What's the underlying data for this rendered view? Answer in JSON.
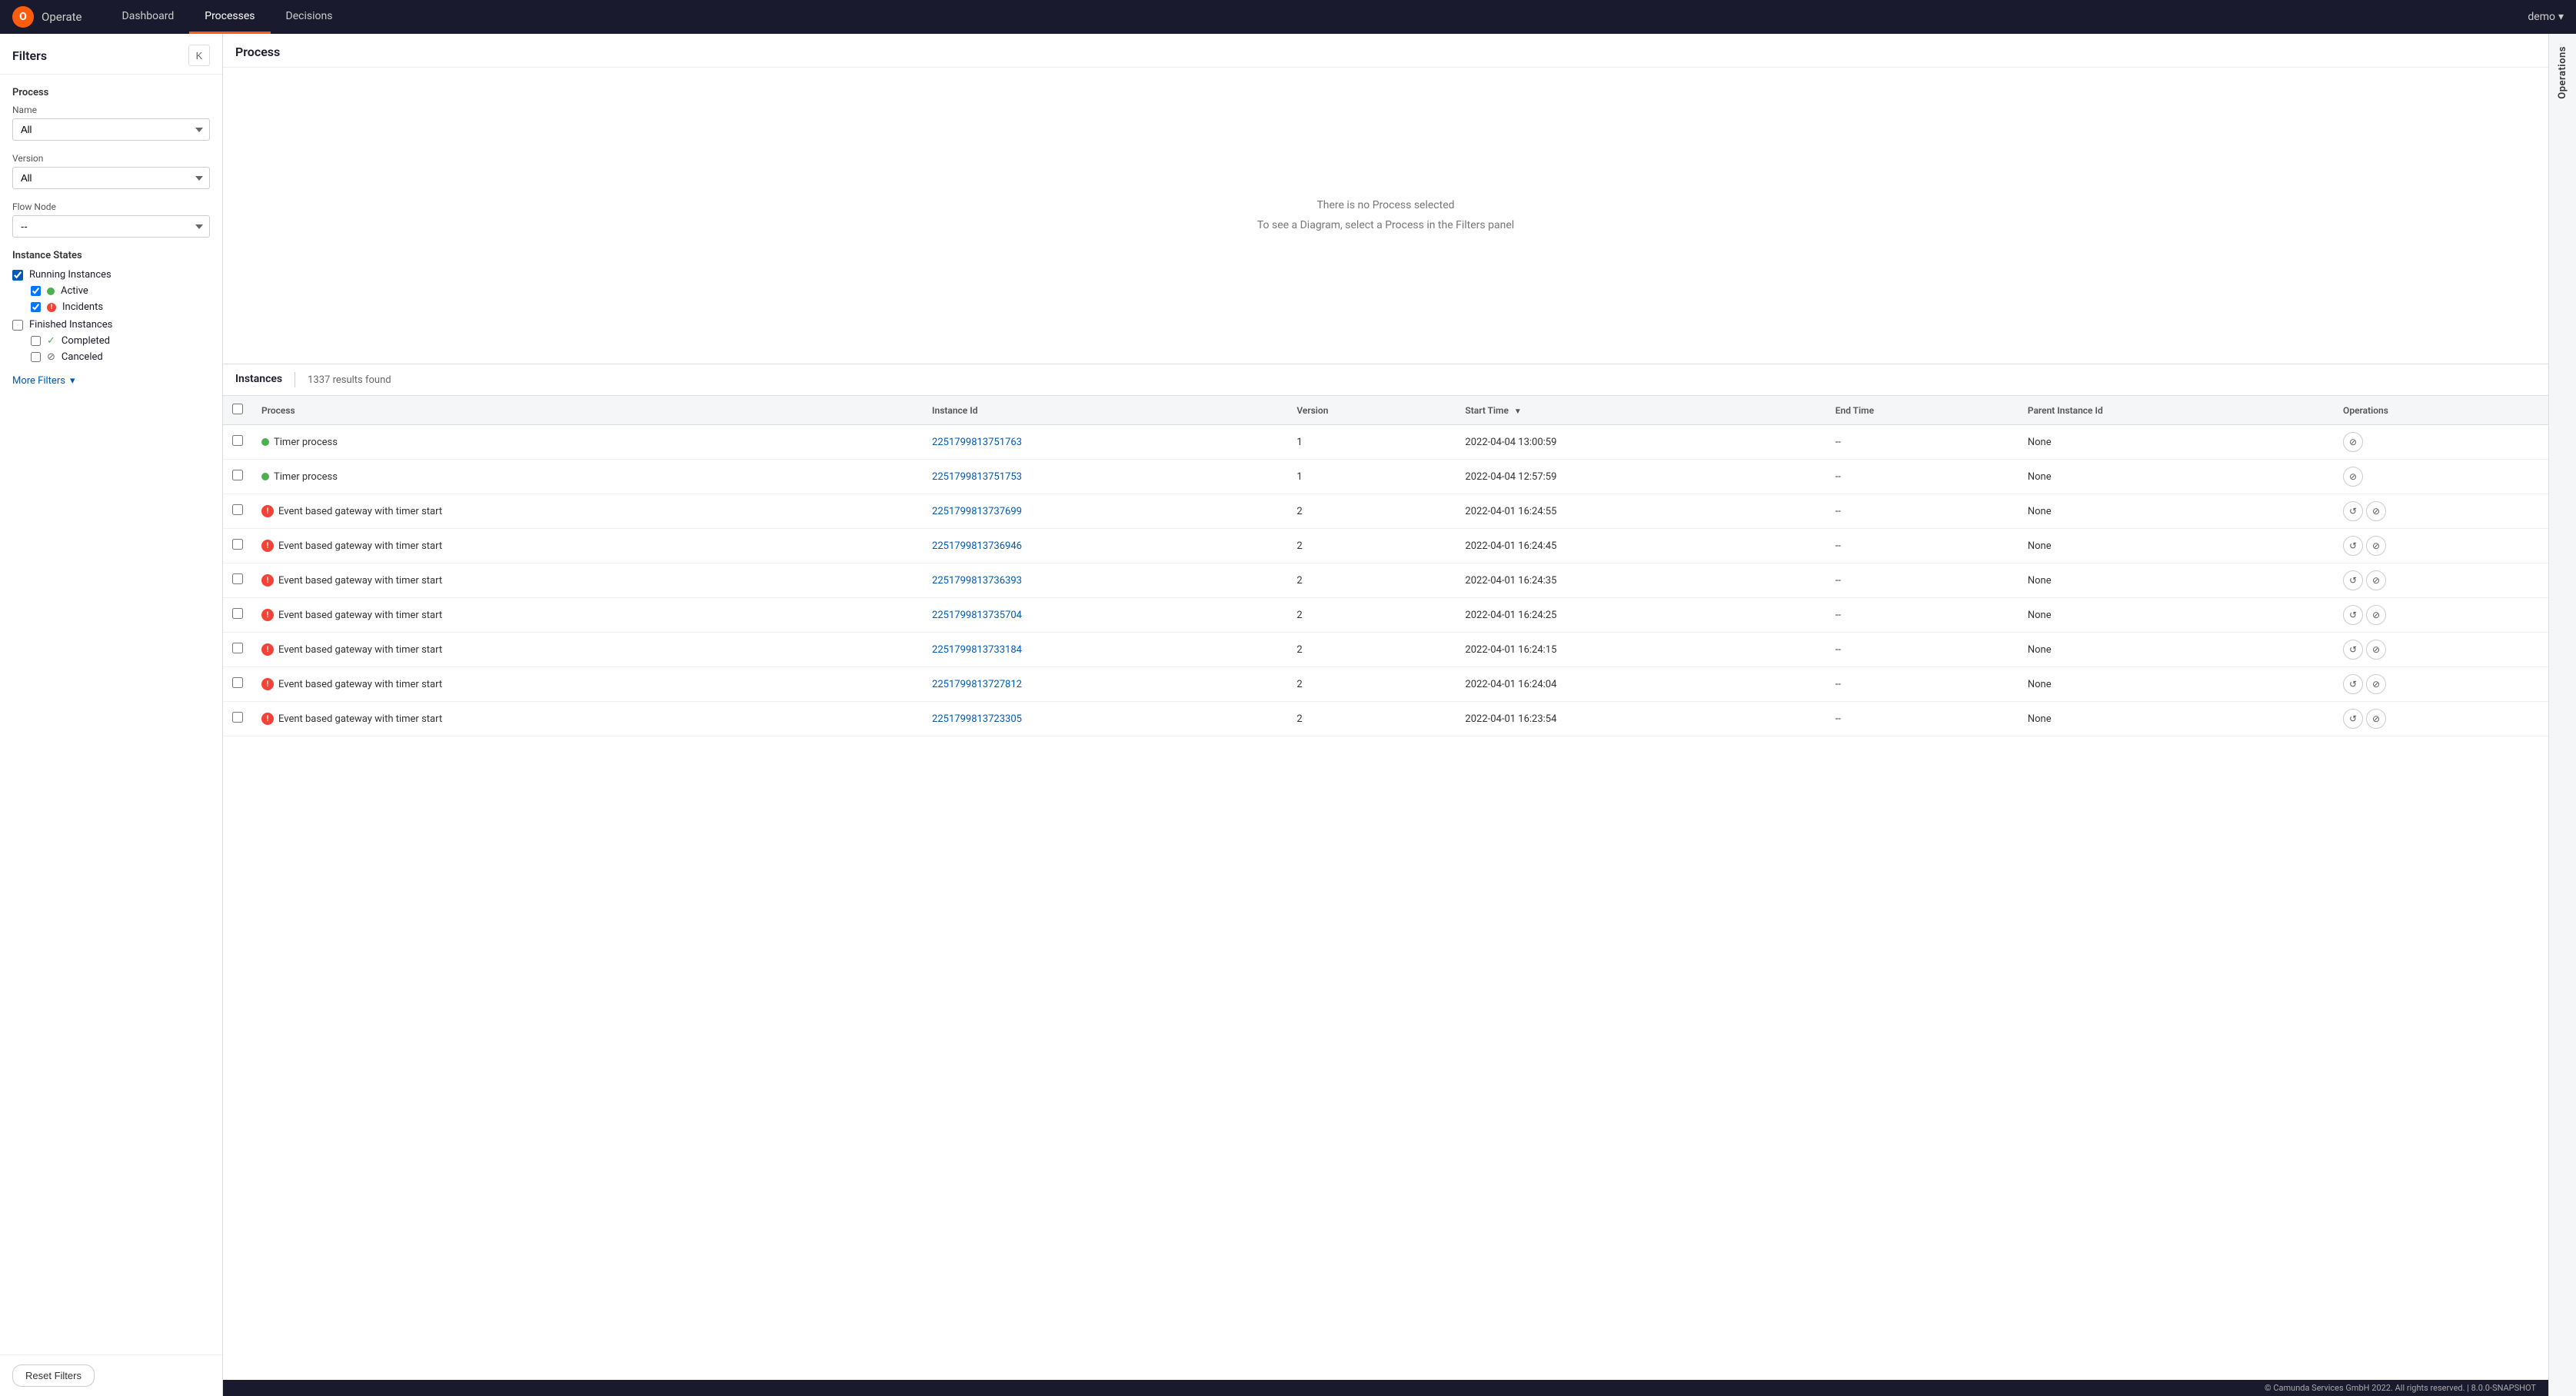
{
  "nav": {
    "logo_text": "O",
    "app_name": "Operate",
    "links": [
      {
        "label": "Dashboard",
        "active": false
      },
      {
        "label": "Processes",
        "active": true
      },
      {
        "label": "Decisions",
        "active": false
      }
    ],
    "user": "demo"
  },
  "filters": {
    "title": "Filters",
    "collapse_label": "K",
    "process_section": {
      "title": "Process",
      "name_label": "Name",
      "name_value": "All",
      "version_label": "Version",
      "version_value": "All",
      "flow_node_label": "Flow Node",
      "flow_node_value": "--"
    },
    "instance_states": {
      "title": "Instance States",
      "running_instances_label": "Running Instances",
      "running_checked": true,
      "active_label": "Active",
      "active_checked": true,
      "incidents_label": "Incidents",
      "incidents_checked": true,
      "finished_instances_label": "Finished Instances",
      "finished_checked": false,
      "completed_label": "Completed",
      "completed_checked": false,
      "canceled_label": "Canceled",
      "canceled_checked": false
    },
    "more_filters_label": "More Filters",
    "reset_button_label": "Reset Filters"
  },
  "process_panel": {
    "title": "Process",
    "empty_line1": "There is no Process selected",
    "empty_line2": "To see a Diagram, select a Process in the Filters panel"
  },
  "instances": {
    "tab_label": "Instances",
    "results_count": "1337 results found",
    "columns": [
      "",
      "Process",
      "Instance Id",
      "Version",
      "Start Time",
      "End Time",
      "Parent Instance Id",
      "Operations"
    ],
    "rows": [
      {
        "id": "2251799813751763",
        "process": "Timer process",
        "status": "green",
        "version": "1",
        "start_time": "2022-04-04 13:00:59",
        "end_time": "--",
        "parent": "None",
        "ops": [
          "cancel"
        ]
      },
      {
        "id": "2251799813751753",
        "process": "Timer process",
        "status": "green",
        "version": "1",
        "start_time": "2022-04-04 12:57:59",
        "end_time": "--",
        "parent": "None",
        "ops": [
          "cancel"
        ]
      },
      {
        "id": "2251799813737699",
        "process": "Event based gateway with timer start",
        "status": "red",
        "version": "2",
        "start_time": "2022-04-01 16:24:55",
        "end_time": "--",
        "parent": "None",
        "ops": [
          "retry",
          "cancel"
        ]
      },
      {
        "id": "2251799813736946",
        "process": "Event based gateway with timer start",
        "status": "red",
        "version": "2",
        "start_time": "2022-04-01 16:24:45",
        "end_time": "--",
        "parent": "None",
        "ops": [
          "retry",
          "cancel"
        ]
      },
      {
        "id": "2251799813736393",
        "process": "Event based gateway with timer start",
        "status": "red",
        "version": "2",
        "start_time": "2022-04-01 16:24:35",
        "end_time": "--",
        "parent": "None",
        "ops": [
          "retry",
          "cancel"
        ]
      },
      {
        "id": "2251799813735704",
        "process": "Event based gateway with timer start",
        "status": "red",
        "version": "2",
        "start_time": "2022-04-01 16:24:25",
        "end_time": "--",
        "parent": "None",
        "ops": [
          "retry",
          "cancel"
        ]
      },
      {
        "id": "2251799813733184",
        "process": "Event based gateway with timer start",
        "status": "red",
        "version": "2",
        "start_time": "2022-04-01 16:24:15",
        "end_time": "--",
        "parent": "None",
        "ops": [
          "retry",
          "cancel"
        ]
      },
      {
        "id": "2251799813727812",
        "process": "Event based gateway with timer start",
        "status": "red",
        "version": "2",
        "start_time": "2022-04-01 16:24:04",
        "end_time": "--",
        "parent": "None",
        "ops": [
          "retry",
          "cancel"
        ]
      },
      {
        "id": "2251799813723305",
        "process": "Event based gateway with timer start",
        "status": "red",
        "version": "2",
        "start_time": "2022-04-01 16:23:54",
        "end_time": "--",
        "parent": "None",
        "ops": [
          "retry",
          "cancel"
        ]
      }
    ]
  },
  "right_sidebar": {
    "label": "Operations"
  },
  "footer": {
    "text": "© Camunda Services GmbH 2022. All rights reserved. | 8.0.0-SNAPSHOT"
  }
}
